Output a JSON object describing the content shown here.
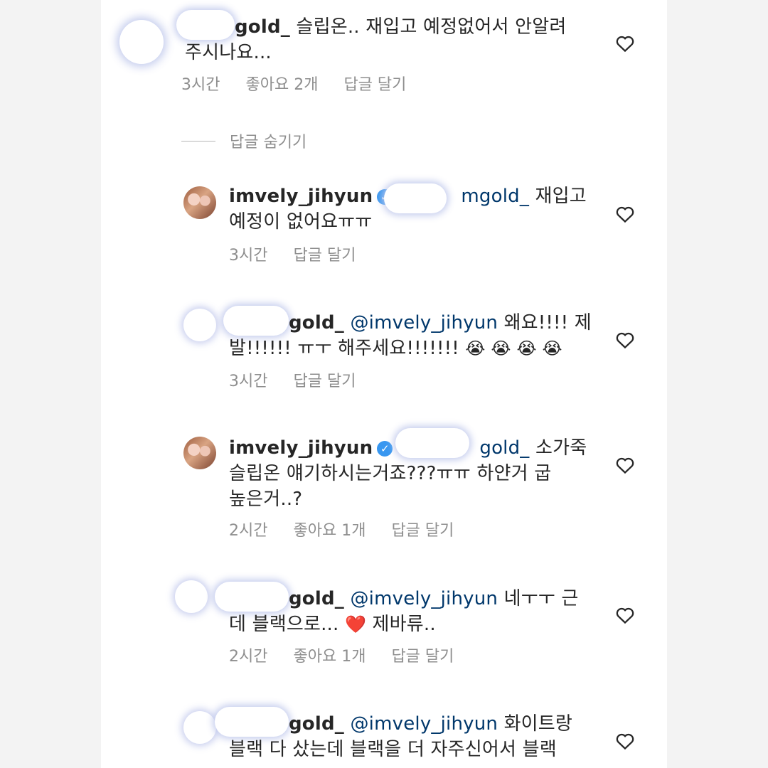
{
  "comments": [
    {
      "username": "gold_",
      "text_line1": "슬립온.. 재입고 예정없어서 안알려",
      "text_line2": "주시나요...",
      "time": "3시간",
      "likes": "좋아요 2개",
      "reply": "답글 달기"
    },
    {
      "username": "imvely_jihyun",
      "mention": "mgold_",
      "text_line1": "재입고",
      "text_line2": "예정이 없어요ㅠㅠ",
      "time": "3시간",
      "reply": "답글 달기"
    },
    {
      "username": "gold_",
      "mention": "@imvely_jihyun",
      "text_line1": "왜요!!!! 제",
      "text_line2": "발!!!!!! ㅠㅜ 해주세요!!!!!!!",
      "emoji": "😭 😭 😭 😭",
      "time": "3시간",
      "reply": "답글 달기"
    },
    {
      "username": "imvely_jihyun",
      "mention": "gold_",
      "text_line1": "소가죽",
      "text_line2": "슬립온 얘기하시는거죠???ㅠㅠ 하얀거 굽",
      "text_line3": "높은거..?",
      "time": "2시간",
      "likes": "좋아요 1개",
      "reply": "답글 달기"
    },
    {
      "username": "gold_",
      "mention": "@imvely_jihyun",
      "text_line1": "네ㅜㅜ 근",
      "text_line2": "데 블랙으로...",
      "emoji": "❤️",
      "text_line2b": "제바류..",
      "time": "2시간",
      "likes": "좋아요 1개",
      "reply": "답글 달기"
    },
    {
      "username": "gold_",
      "mention": "@imvely_jihyun",
      "text_line1": "화이트랑",
      "text_line2": "블랙 다 샀는데 블랙을 더 자주신어서 블랙"
    }
  ],
  "hide_replies": "답글 숨기기",
  "colors": {
    "mention": "#00376b",
    "meta": "#8e8e8e",
    "verified": "#3897f0"
  }
}
